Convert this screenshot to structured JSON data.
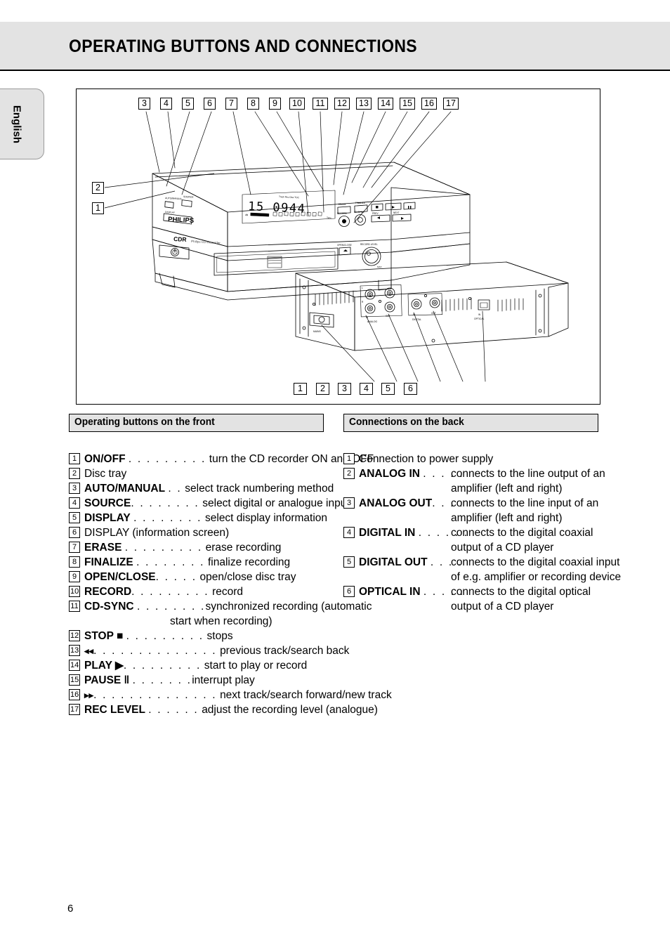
{
  "header": {
    "title": "OPERATING BUTTONS AND CONNECTIONS"
  },
  "language_tab": {
    "label": "English"
  },
  "figure": {
    "brand": "PHILIPS",
    "model_line": "CDR",
    "model_sub": "Philips CD-R/CD-RW/CDR",
    "display_value": "15  0944",
    "top_callouts": [
      "3",
      "4",
      "5",
      "6",
      "7",
      "8",
      "9",
      "10",
      "11",
      "12",
      "13",
      "14",
      "15",
      "16",
      "17"
    ],
    "left_callouts": [
      "2",
      "1"
    ],
    "bottom_callouts": [
      "1",
      "2",
      "3",
      "4",
      "5",
      "6"
    ],
    "rear_labels": {
      "mains": "MAINS",
      "analog": "ANALOG",
      "digital": "DIGITAL",
      "optical": "OPTICAL",
      "in": "IN",
      "out": "OUT",
      "left": "L",
      "right": "R"
    }
  },
  "sections": {
    "front": {
      "title": "Operating buttons on the front"
    },
    "back": {
      "title": "Connections on the back"
    }
  },
  "front_items": [
    {
      "num": "1",
      "name": "ON/OFF",
      "dots": ". . . . . . . . .",
      "desc": "turn the CD recorder ON and OFF",
      "bold": true
    },
    {
      "num": "2",
      "name": "Disc tray",
      "dots": "",
      "desc": "",
      "bold": false
    },
    {
      "num": "3",
      "name": "AUTO/MANUAL",
      "dots": ". .",
      "desc": "select track numbering method",
      "bold": true
    },
    {
      "num": "4",
      "name": "SOURCE",
      "dots": ". . . . . . . .",
      "desc": "select digital or analogue input",
      "bold": true
    },
    {
      "num": "5",
      "name": "DISPLAY",
      "dots": ". . . . . . . .",
      "desc": "select display information",
      "bold": true
    },
    {
      "num": "6",
      "name": "DISPLAY (information screen)",
      "dots": "",
      "desc": "",
      "bold": false
    },
    {
      "num": "7",
      "name": "ERASE",
      "dots": ". . . . . . . . .",
      "desc": "erase recording",
      "bold": true
    },
    {
      "num": "8",
      "name": "FINALIZE",
      "dots": ". . . . . . . .",
      "desc": "finalize recording",
      "bold": true
    },
    {
      "num": "9",
      "name": "OPEN/CLOSE",
      "dots": ". . . . .",
      "desc": "open/close disc tray",
      "bold": true
    },
    {
      "num": "10",
      "name": "RECORD",
      "dots": ". . . . . . . . .",
      "desc": "record",
      "bold": true
    },
    {
      "num": "11",
      "name": "CD-SYNC",
      "dots": ". . . . . . . .",
      "desc": "synchronized recording (automatic",
      "desc2": "start when recording)",
      "bold": true
    },
    {
      "num": "12",
      "name": "STOP ■",
      "dots": ". . . . . . . . .",
      "desc": "stops",
      "bold": true
    },
    {
      "num": "13",
      "name": "◂◂",
      "dots": ". . . . . . . . . . . . . .",
      "desc": "previous track/search back",
      "bold": false
    },
    {
      "num": "14",
      "name": "PLAY  ▶",
      "dots": ". . . . . . . . .",
      "desc": "start to play or record",
      "bold": true
    },
    {
      "num": "15",
      "name": "PAUSE ‖",
      "dots": ". . . . . . .",
      "desc": "interrupt play",
      "bold": true
    },
    {
      "num": "16",
      "name": "▸▸",
      "dots": ". . . . . . . . . . . . . .",
      "desc": "next track/search forward/new track",
      "bold": false
    },
    {
      "num": "17",
      "name": "REC LEVEL",
      "dots": ". . . . . .",
      "desc": "adjust the recording level (analogue)",
      "bold": true
    }
  ],
  "back_items": [
    {
      "num": "1",
      "name": "Connection to power supply",
      "dots": "",
      "desc": "",
      "desc2": "",
      "bold": false
    },
    {
      "num": "2",
      "name": "ANALOG IN",
      "dots": ". . . . .",
      "desc": "connects to the line output of an",
      "desc2": "amplifier (left and right)",
      "bold": true
    },
    {
      "num": "3",
      "name": "ANALOG OUT",
      "dots": ". . . .",
      "desc": "connects to the line input of an",
      "desc2": "amplifier (left and right)",
      "bold": true
    },
    {
      "num": "4",
      "name": "DIGITAL IN",
      "dots": ". . . . . .",
      "desc": "connects to the digital coaxial",
      "desc2": "output of a CD player",
      "bold": true
    },
    {
      "num": "5",
      "name": "DIGITAL OUT",
      "dots": ". . . .",
      "desc": "connects to the digital coaxial input",
      "desc2": "of e.g. amplifier or recording device",
      "bold": true
    },
    {
      "num": "6",
      "name": "OPTICAL IN",
      "dots": ". . . . .",
      "desc": "connects to the digital optical",
      "desc2": "output of a CD player",
      "bold": true
    }
  ],
  "footer": {
    "page_number": "6"
  }
}
